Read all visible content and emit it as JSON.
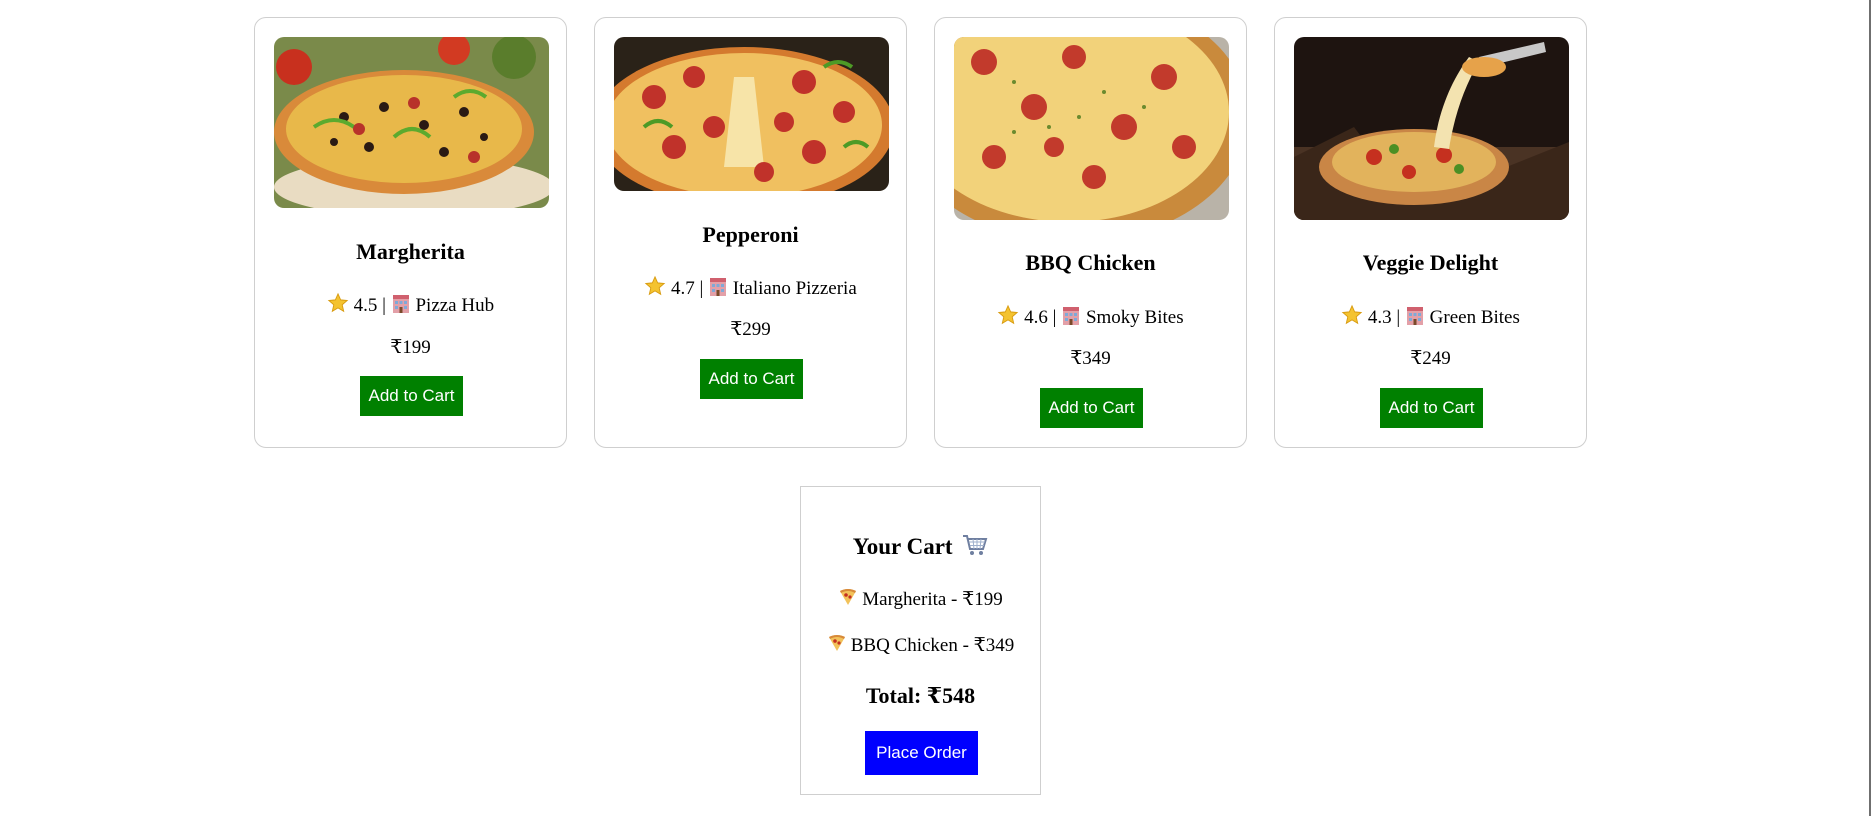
{
  "products": [
    {
      "name": "Margherita",
      "rating": "4.5",
      "restaurant": "Pizza Hub",
      "price": "₹199",
      "button": "Add to Cart",
      "rating_sep": " | "
    },
    {
      "name": "Pepperoni",
      "rating": "4.7",
      "restaurant": "Italiano Pizzeria",
      "price": "₹299",
      "button": "Add to Cart",
      "rating_sep": " | "
    },
    {
      "name": "BBQ Chicken",
      "rating": "4.6",
      "restaurant": "Smoky Bites",
      "price": "₹349",
      "button": "Add to Cart",
      "rating_sep": " | "
    },
    {
      "name": "Veggie Delight",
      "rating": "4.3",
      "restaurant": "Green Bites",
      "price": "₹249",
      "button": "Add to Cart",
      "rating_sep": " | "
    }
  ],
  "cart": {
    "title": "Your Cart",
    "items": [
      "Margherita - ₹199",
      "BBQ Chicken - ₹349"
    ],
    "total": "Total: ₹548",
    "button": "Place Order"
  },
  "colors": {
    "add_button": "#008000",
    "order_button": "#0000ff"
  },
  "icons": {
    "rating": "star-icon",
    "restaurant": "building-icon",
    "cart": "shopping-cart-icon",
    "item": "pizza-slice-icon"
  }
}
